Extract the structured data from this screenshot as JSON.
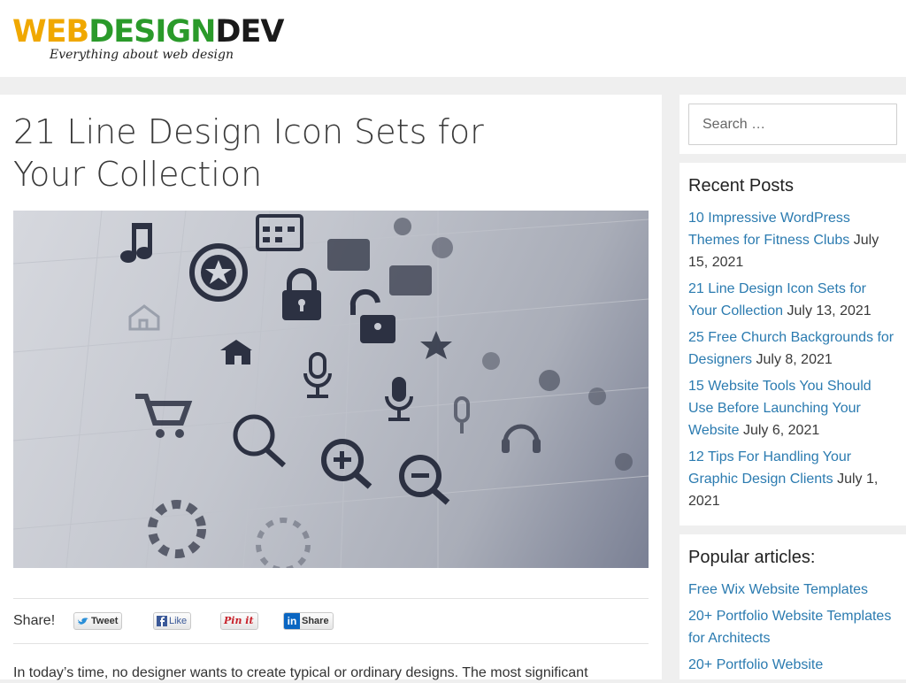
{
  "site": {
    "logo_web": "WEB",
    "logo_design": "DESIGN",
    "logo_dev": "DEV",
    "tagline": "Everything about web design",
    "colors": {
      "logo_yellow": "#f0a800",
      "logo_green": "#2a9a2a",
      "link": "#2b7bb0"
    }
  },
  "post": {
    "title": "21 Line Design Icon Sets for Your Collection",
    "hero_image": "grid of line icons (music, star, lock, home, microphone, cart, magnifier, zoom-in, zoom-out, headphones)",
    "intro": "In today’s time, no designer wants to create typical or ordinary designs. The most significant"
  },
  "share": {
    "label": "Share!",
    "tweet": "Tweet",
    "like": "Like",
    "pinit": "Pin it",
    "linkedin": "Share"
  },
  "sidebar": {
    "search_placeholder": "Search …",
    "recent_title": "Recent Posts",
    "recent_posts": [
      {
        "title": "10 Impressive WordPress Themes for Fitness Clubs",
        "date": "July 15, 2021"
      },
      {
        "title": "21 Line Design Icon Sets for Your Collection",
        "date": "July 13, 2021"
      },
      {
        "title": "25 Free Church Backgrounds for Designers",
        "date": "July 8, 2021"
      },
      {
        "title": "15 Website Tools You Should Use Before Launching Your Website",
        "date": "July 6, 2021"
      },
      {
        "title": "12 Tips For Handling Your Graphic Design Clients",
        "date": "July 1, 2021"
      }
    ],
    "popular_title": "Popular articles:",
    "popular_posts": [
      {
        "title": "Free Wix Website Templates"
      },
      {
        "title": "20+ Portfolio Website Templates for Architects"
      },
      {
        "title": "20+ Portfolio Website"
      }
    ]
  }
}
